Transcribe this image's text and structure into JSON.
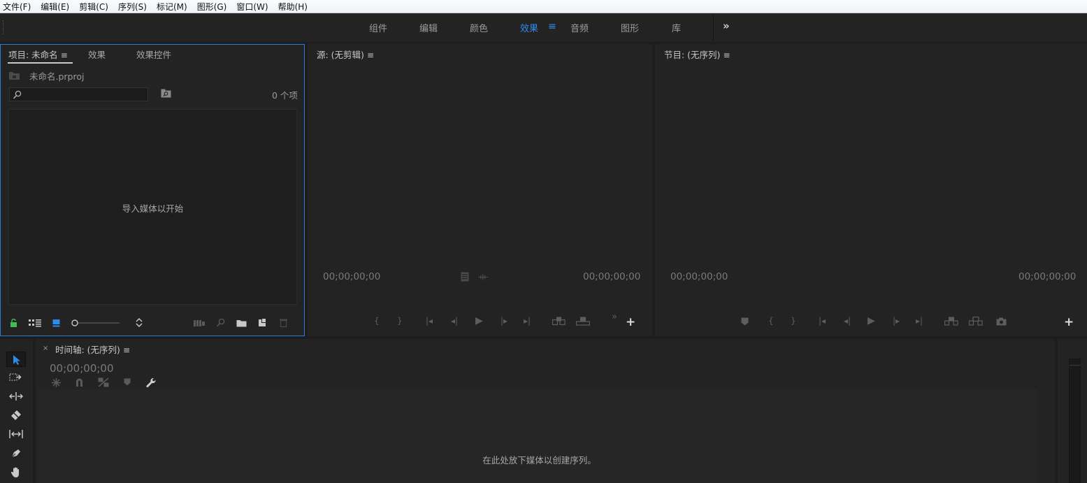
{
  "menubar": {
    "items": [
      "文件(F)",
      "编辑(E)",
      "剪辑(C)",
      "序列(S)",
      "标记(M)",
      "图形(G)",
      "窗口(W)",
      "帮助(H)"
    ]
  },
  "workspaces": {
    "items": [
      "组件",
      "编辑",
      "颜色",
      "效果",
      "音频",
      "图形",
      "库"
    ],
    "active": "效果",
    "menu_glyph": "≡",
    "more_glyph": "»"
  },
  "project_panel": {
    "tabs": [
      "项目: 未命名",
      "效果",
      "效果控件"
    ],
    "project_file": "未命名.prproj",
    "search_placeholder": "",
    "item_count": "0 个项",
    "empty_message": "导入媒体以开始"
  },
  "source_monitor": {
    "title": "源: (无剪辑)",
    "timecode_in": "00;00;00;00",
    "timecode_out": "00;00;00;00"
  },
  "program_monitor": {
    "title": "节目: (无序列)",
    "timecode_in": "00;00;00;00",
    "timecode_out": "00;00;00;00"
  },
  "timeline": {
    "close_glyph": "×",
    "title": "时间轴: (无序列)",
    "timecode": "00;00;00;00",
    "empty_message": "在此处放下媒体以创建序列。"
  },
  "colors": {
    "accent": "#2d8ceb",
    "panel_bg": "#232323",
    "active_panel_border": "#2f7ad6"
  },
  "icons": {
    "menu": "hamburger-icon",
    "more": "double-chevron-icon"
  }
}
